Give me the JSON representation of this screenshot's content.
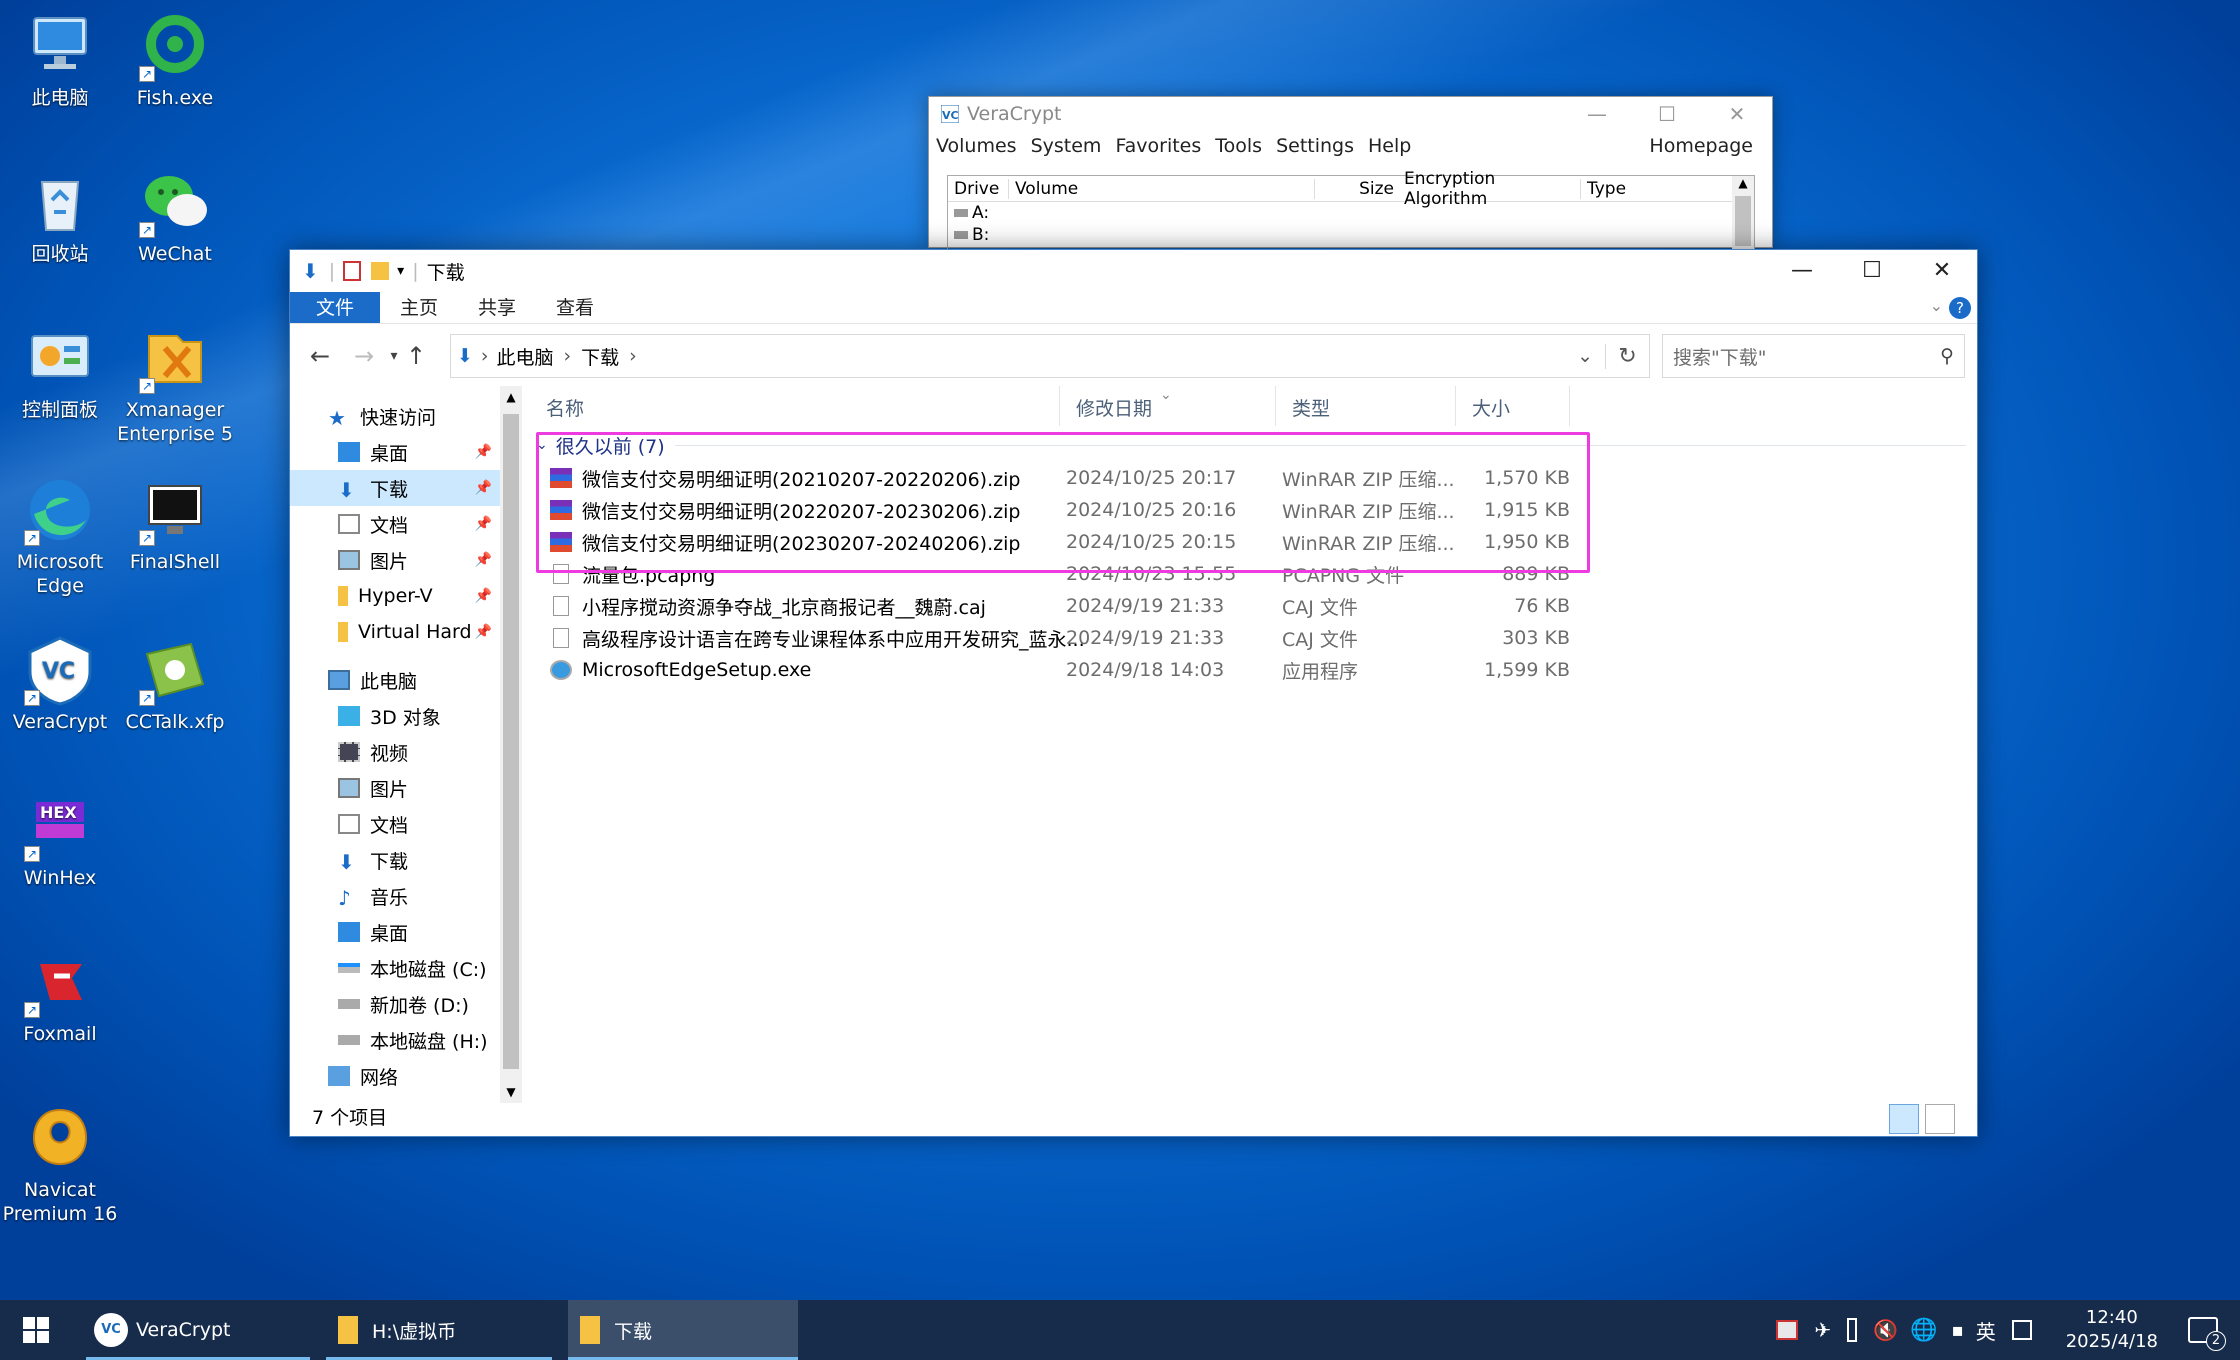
{
  "desktop": {
    "icons": [
      "此电脑",
      "Fish.exe",
      "回收站",
      "WeChat",
      "控制面板",
      "Xmanager\nEnterprise 5",
      "Microsoft\nEdge",
      "FinalShell",
      "VeraCrypt",
      "CCTalk.xfp",
      "WinHex",
      "Foxmail",
      "Navicat\nPremium 16"
    ]
  },
  "veracrypt": {
    "title": "VeraCrypt",
    "menu": [
      "Volumes",
      "System",
      "Favorites",
      "Tools",
      "Settings",
      "Help"
    ],
    "homepage": "Homepage",
    "columns": [
      "Drive",
      "Volume",
      "Size",
      "Encryption Algorithm",
      "Type"
    ],
    "drives": [
      "A:",
      "B:"
    ]
  },
  "explorer": {
    "title": "下载",
    "ribbon": {
      "file": "文件",
      "home": "主页",
      "share": "共享",
      "view": "查看"
    },
    "address": [
      "此电脑",
      "下载"
    ],
    "search_placeholder": "搜索\"下载\"",
    "nav": {
      "quick_access": "快速访问",
      "quick_items": [
        "桌面",
        "下载",
        "文档",
        "图片",
        "Hyper-V",
        "Virtual Hard"
      ],
      "this_pc": "此电脑",
      "pc_items": [
        "3D 对象",
        "视频",
        "图片",
        "文档",
        "下载",
        "音乐",
        "桌面",
        "本地磁盘 (C:)",
        "新加卷 (D:)",
        "本地磁盘 (H:)"
      ],
      "network": "网络"
    },
    "columns": {
      "name": "名称",
      "date": "修改日期",
      "type": "类型",
      "size": "大小"
    },
    "group": "很久以前 (7)",
    "files": [
      {
        "name": "微信支付交易明细证明(20210207-20220206).zip",
        "date": "2024/10/25 20:17",
        "type": "WinRAR ZIP 压缩...",
        "size": "1,570 KB"
      },
      {
        "name": "微信支付交易明细证明(20220207-20230206).zip",
        "date": "2024/10/25 20:16",
        "type": "WinRAR ZIP 压缩...",
        "size": "1,915 KB"
      },
      {
        "name": "微信支付交易明细证明(20230207-20240206).zip",
        "date": "2024/10/25 20:15",
        "type": "WinRAR ZIP 压缩...",
        "size": "1,950 KB"
      },
      {
        "name": "流量包.pcapng",
        "date": "2024/10/23 15:55",
        "type": "PCAPNG 文件",
        "size": "889 KB"
      },
      {
        "name": "小程序搅动资源争夺战_北京商报记者__魏蔚.caj",
        "date": "2024/9/19 21:33",
        "type": "CAJ 文件",
        "size": "76 KB"
      },
      {
        "name": "高级程序设计语言在跨专业课程体系中应用开发研究_蓝永...",
        "date": "2024/9/19 21:33",
        "type": "CAJ 文件",
        "size": "303 KB"
      },
      {
        "name": "MicrosoftEdgeSetup.exe",
        "date": "2024/9/18 14:03",
        "type": "应用程序",
        "size": "1,599 KB"
      }
    ],
    "status": "7 个项目"
  },
  "taskbar": {
    "tasks": [
      "VeraCrypt",
      "H:\\虚拟币",
      "下载"
    ],
    "ime": "英",
    "time": "12:40",
    "date": "2025/4/18",
    "notif_count": "2"
  },
  "colors": {
    "accent": "#1a6cc8",
    "highlight": "#ee3be0",
    "taskbar": "#172c4a"
  }
}
